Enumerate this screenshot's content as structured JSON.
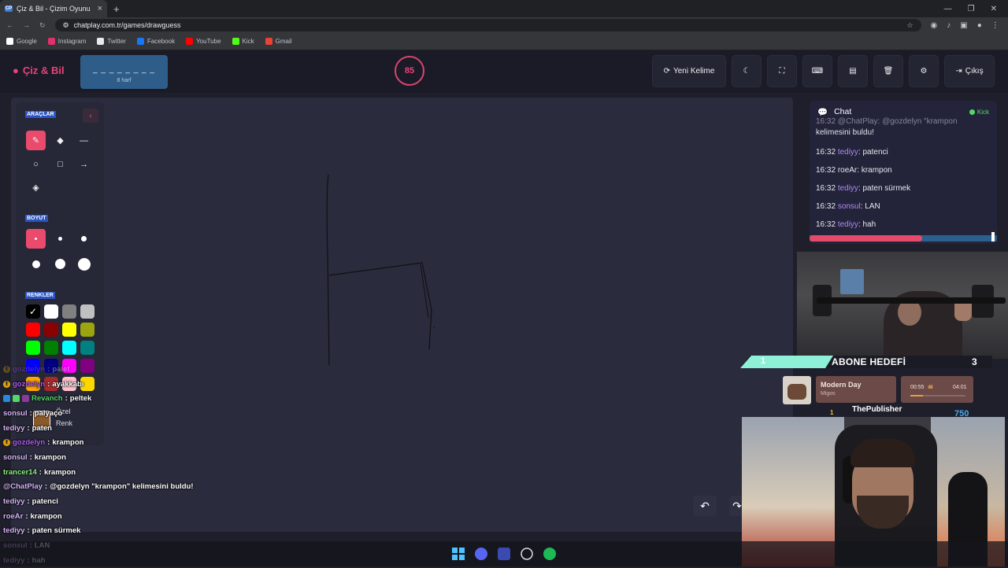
{
  "browser": {
    "tab_title": "Çiz & Bil - Çizim Oyunu",
    "tab_favicon": "CP",
    "url": "chatplay.com.tr/games/drawguess",
    "bookmarks": [
      {
        "label": "Google",
        "icon": "google-icon",
        "color": "#ffffff"
      },
      {
        "label": "Instagram",
        "icon": "instagram-icon",
        "color": "#e1306c"
      },
      {
        "label": "Twitter",
        "icon": "twitter-icon",
        "color": "#e8eaed"
      },
      {
        "label": "Facebook",
        "icon": "facebook-icon",
        "color": "#1877f2"
      },
      {
        "label": "YouTube",
        "icon": "youtube-icon",
        "color": "#ff0000"
      },
      {
        "label": "Kick",
        "icon": "kick-icon",
        "color": "#53fc18"
      },
      {
        "label": "Gmail",
        "icon": "gmail-icon",
        "color": "#ea4335"
      }
    ]
  },
  "header": {
    "logo_text": "Çiz & Bil",
    "word_blanks": "_ _ _ _ _ _ _ _",
    "word_count": "8 harf",
    "timer": "85",
    "new_word_label": "Yeni Kelime",
    "exit_label": "Çıkış",
    "accent": "#e8437a"
  },
  "tools": {
    "section_tools": "ARAÇLAR",
    "section_size": "BOYUT",
    "section_colors": "RENKLER",
    "custom_color_l1": "Özel",
    "custom_color_l2": "Renk",
    "colors": [
      "#000000",
      "#ffffff",
      "#808080",
      "#c0c0c0",
      "#ff0000",
      "#8b0000",
      "#ffff00",
      "#9aa50f",
      "#00ff00",
      "#008000",
      "#00ffff",
      "#008080",
      "#0000ff",
      "#000080",
      "#ff00ff",
      "#800080",
      "#ffa500",
      "#a52a2a",
      "#ffc0cb",
      "#ffd700"
    ]
  },
  "overlay_chat": [
    {
      "user": "gozdelyn",
      "text": "palet",
      "color": "#b15df0",
      "badge": "gold",
      "faded": true
    },
    {
      "user": "gozdelyn",
      "text": "ayakkabı",
      "color": "#b15df0",
      "badge": "gold",
      "faded": false
    },
    {
      "user": "Revanch",
      "text": "peltek",
      "color": "#53d769",
      "badge": "multi",
      "faded": false
    },
    {
      "user": "sonsul",
      "text": "palyaço",
      "color": "#d8b4f8",
      "badge": "",
      "faded": false
    },
    {
      "user": "tediyy",
      "text": "paten",
      "color": "#d8b4f8",
      "badge": "",
      "faded": false
    },
    {
      "user": "gozdelyn",
      "text": "krampon",
      "color": "#b15df0",
      "badge": "gold",
      "faded": false
    },
    {
      "user": "sonsul",
      "text": "krampon",
      "color": "#d8b4f8",
      "badge": "",
      "faded": false
    },
    {
      "user": "trancer14",
      "text": "krampon",
      "color": "#8cf27a",
      "badge": "",
      "faded": false
    },
    {
      "user": "@ChatPlay",
      "text": "@gozdelyn \"krampon\" kelimesini buldu!",
      "color": "#d8b4f8",
      "badge": "",
      "faded": false
    },
    {
      "user": "tediyy",
      "text": "patenci",
      "color": "#d8b4f8",
      "badge": "",
      "faded": false
    },
    {
      "user": "roeAr",
      "text": "krampon",
      "color": "#d8b4f8",
      "badge": "",
      "faded": false
    },
    {
      "user": "tediyy",
      "text": "paten sürmek",
      "color": "#d8b4f8",
      "badge": "",
      "faded": false
    },
    {
      "user": "sonsul",
      "text": "LAN",
      "color": "#d8b4f8",
      "badge": "",
      "faded": false
    },
    {
      "user": "tediyy",
      "text": "hah",
      "color": "#d8b4f8",
      "badge": "",
      "faded": false
    }
  ],
  "side_chat": {
    "title": "Chat",
    "platform": "Kick",
    "top_partial_1": "16:32 @ChatPlay: @gozdelyn \"krampon",
    "top_partial_2": "kelimesini buldu!",
    "messages": [
      {
        "time": "16:32",
        "user": "tediyy",
        "text": "patenci",
        "ucolor": "#b088f0"
      },
      {
        "time": "16:32",
        "user": "roeAr",
        "text": "krampon",
        "ucolor": "#e8e8ee"
      },
      {
        "time": "16:32",
        "user": "tediyy",
        "text": "paten sürmek",
        "ucolor": "#b088f0"
      },
      {
        "time": "16:32",
        "user": "sonsul",
        "text": "LAN",
        "ucolor": "#b088f0"
      },
      {
        "time": "16:32",
        "user": "tediyy",
        "text": "hah",
        "ucolor": "#b088f0"
      }
    ],
    "progress": 0.6
  },
  "sub_goal": {
    "current": "1",
    "title": "ABONE HEDEFİ",
    "target": "3"
  },
  "music": {
    "track": "Modern Day",
    "artist": "Migos",
    "elapsed": "00:55",
    "total": "04:01",
    "progress": 0.23
  },
  "publisher": {
    "rank": "1",
    "name": "ThePublisher",
    "value": "750"
  }
}
